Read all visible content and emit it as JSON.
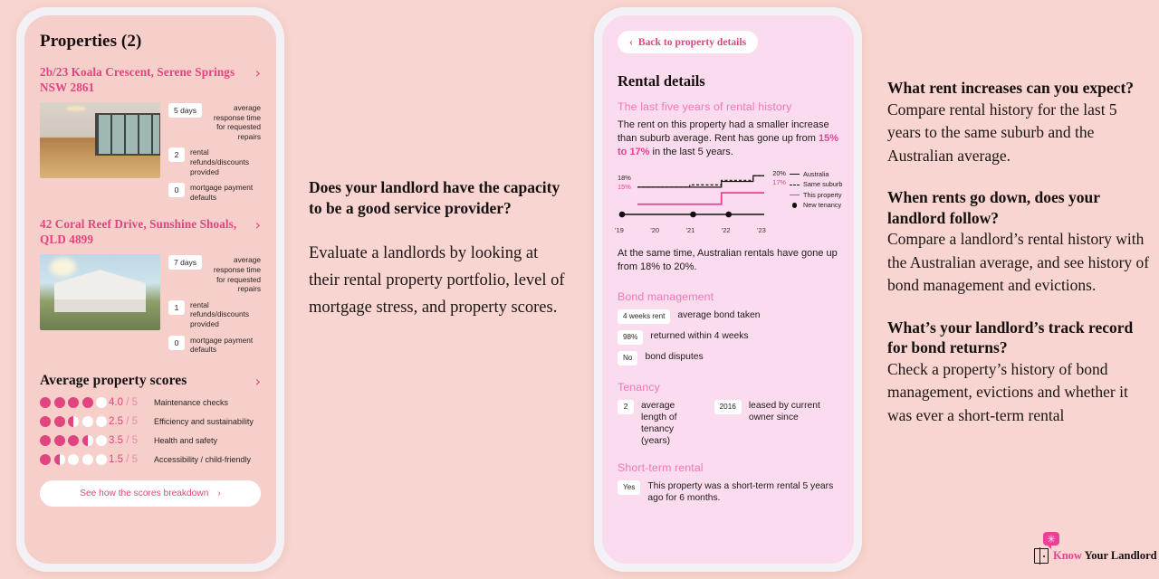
{
  "brand": {
    "name_first": "Know",
    "name_rest": " Your Landlord",
    "bubble_glyph": "✳",
    "accent": "#ec3f96",
    "page_bg": "#f8d5d0"
  },
  "left_phone": {
    "title": "Properties (2)",
    "chevron": "›",
    "properties": [
      {
        "address": "2b/23 Koala Crescent, Serene Springs NSW 2861",
        "stats": [
          {
            "value": "5 days",
            "label": "average response time for requested repairs"
          },
          {
            "value": "2",
            "label": "rental refunds/discounts provided"
          },
          {
            "value": "0",
            "label": "mortgage payment defaults"
          }
        ]
      },
      {
        "address": "42 Coral Reef Drive, Sunshine Shoals, QLD 4899",
        "stats": [
          {
            "value": "7 days",
            "label": "average response time for requested repairs"
          },
          {
            "value": "1",
            "label": "rental refunds/discounts provided"
          },
          {
            "value": "0",
            "label": "mortgage payment defaults"
          }
        ]
      }
    ],
    "scores_title": "Average property scores",
    "scores": [
      {
        "value": "4.0",
        "denominator": "/ 5",
        "label": "Maintenance checks",
        "filled": 4,
        "half": false
      },
      {
        "value": "2.5",
        "denominator": "/ 5",
        "label": "Efficiency and sustainability",
        "filled": 2,
        "half": true
      },
      {
        "value": "3.5",
        "denominator": "/ 5",
        "label": "Health and safety",
        "filled": 3,
        "half": true
      },
      {
        "value": "1.5",
        "denominator": "/ 5",
        "label": "Accessibility / child-friendly",
        "filled": 1,
        "half": true
      }
    ],
    "cta_label": "See how the scores breakdown",
    "cta_chevron": "›"
  },
  "right_phone": {
    "back_label": "Back to property details",
    "back_chevron": "‹",
    "title": "Rental details",
    "section_history": "The last five years of rental history",
    "history_text_1": "The rent on this property had a smaller increase than suburb average. Rent has gone up from ",
    "history_highlight": "15% to 17%",
    "history_text_2": " in the last 5 years.",
    "aus_text": "At the same time, Australian rentals have gone up from 18% to 20%.",
    "section_bond": "Bond management",
    "bond_rows": [
      {
        "value": "4 weeks rent",
        "label": "average bond taken"
      },
      {
        "value": "98%",
        "label": "returned within 4 weeks"
      },
      {
        "value": "No",
        "label": "bond disputes"
      }
    ],
    "section_tenancy": "Tenancy",
    "tenancy_rows": [
      {
        "value": "2",
        "label": "average length of tenancy (years)"
      },
      {
        "value": "2016",
        "label": "leased by current owner since"
      }
    ],
    "section_short": "Short-term rental",
    "short_rows": [
      {
        "value": "Yes",
        "label": "This property was a short-term rental 5 years ago for 6 months."
      }
    ]
  },
  "chart_data": {
    "type": "line",
    "title": "The last five years of rental history",
    "xlabel": "",
    "ylabel": "",
    "x": [
      "'19",
      "'20",
      "'21",
      "'22",
      "'23"
    ],
    "xlim": [
      2019,
      2023
    ],
    "ylim": [
      14,
      21
    ],
    "grid": false,
    "legend_position": "right",
    "start_labels": {
      "australia": "18%",
      "this_property": "15%"
    },
    "end_labels": {
      "australia": "20%",
      "this_property": "17%"
    },
    "series": [
      {
        "name": "Australia",
        "style": "solid-black",
        "color": "#15100f",
        "values": [
          18,
          18,
          18,
          19,
          20
        ]
      },
      {
        "name": "Same suburb",
        "style": "dashed-black",
        "color": "#15100f",
        "values": [
          18,
          18,
          18.4,
          19.2,
          20
        ]
      },
      {
        "name": "This property",
        "style": "solid-pink",
        "color": "#ea3f94",
        "values": [
          15,
          15,
          15,
          17,
          17
        ]
      }
    ],
    "markers": {
      "name": "New tenancy",
      "color": "#15100f",
      "x": [
        "'19",
        "'21",
        "'22"
      ]
    },
    "legend": [
      "Australia",
      "Same suburb",
      "This property",
      "New tenancy"
    ]
  },
  "copy_middle": {
    "question": "Does your landlord have the capacity to be a good service provider?",
    "answer": "Evaluate a landlords by looking at their rental property portfolio, level of mortgage stress, and property scores."
  },
  "copy_right": [
    {
      "question": "What rent increases can you expect?",
      "answer": "Compare rental history for the last 5 years to the same suburb and the Australian average."
    },
    {
      "question": "When rents go down, does your landlord follow?",
      "answer": "Compare a landlord’s rental history with the Australian average, and see history of bond management and evictions."
    },
    {
      "question": "What’s your landlord’s track record for bond returns?",
      "answer": "Check a property’s history of bond management, evictions and whether it was ever a short-term rental"
    }
  ]
}
